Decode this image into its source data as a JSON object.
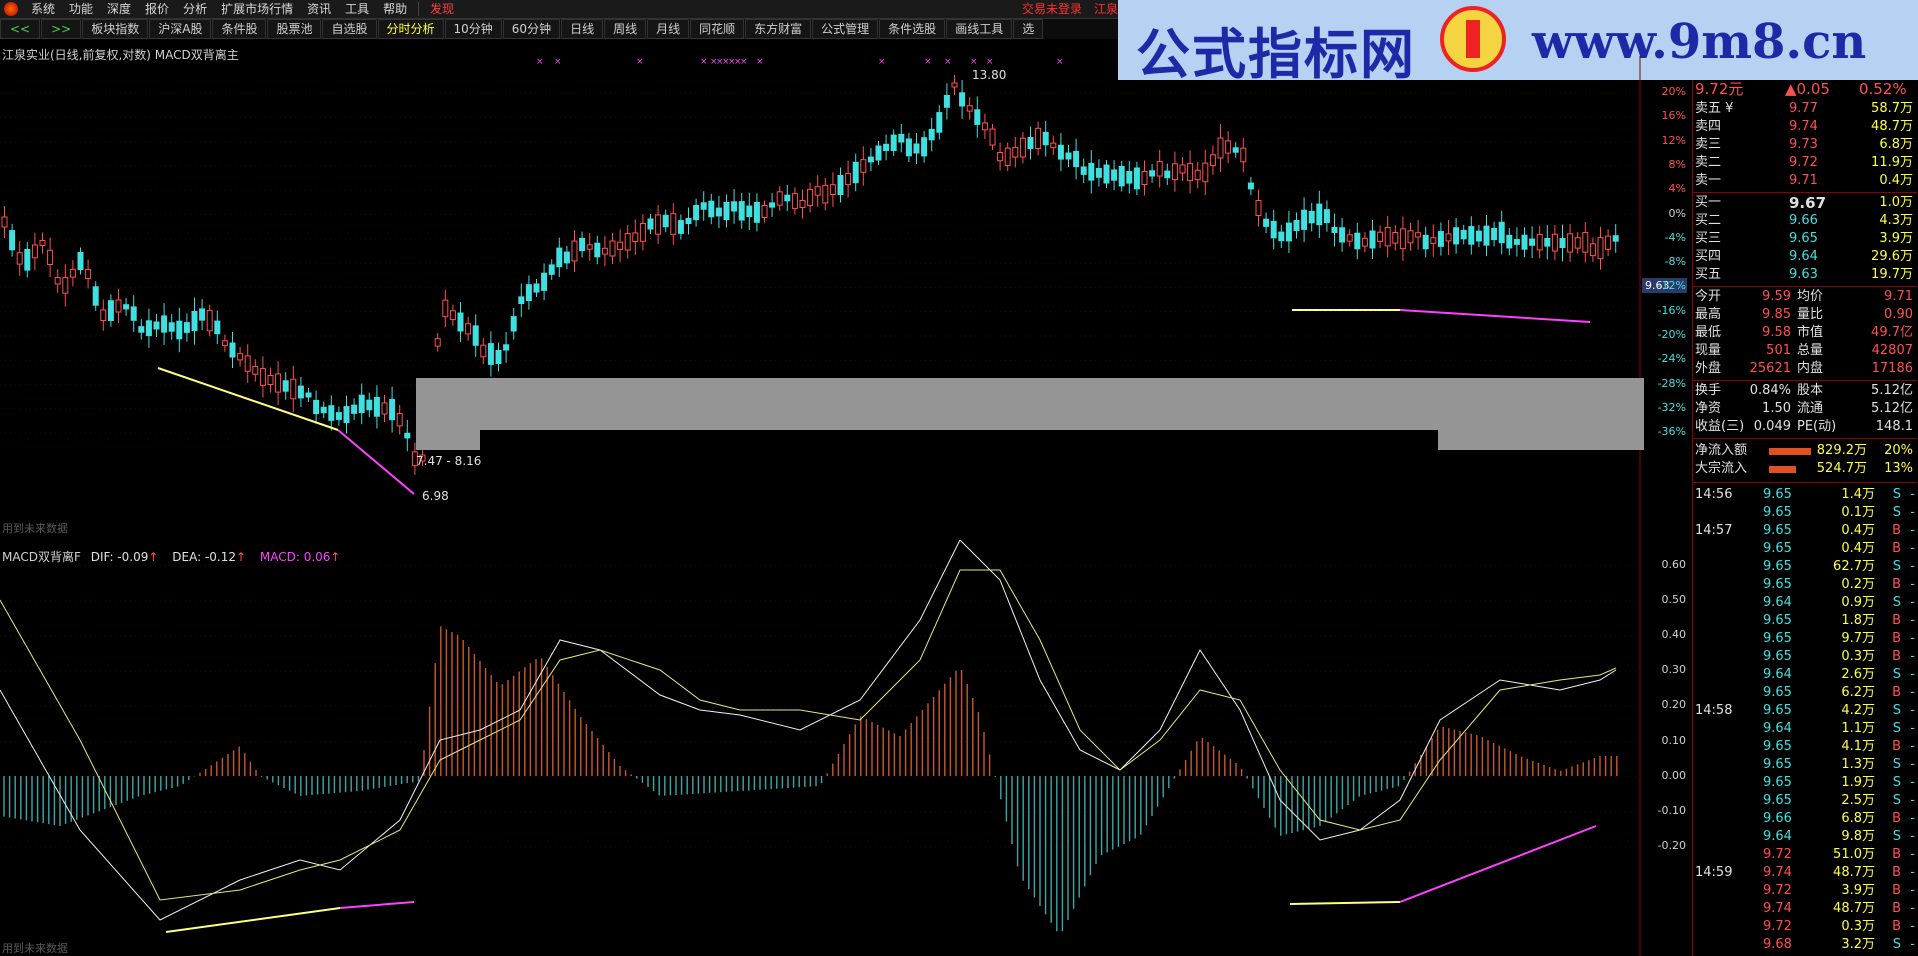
{
  "menu": {
    "items": [
      "系统",
      "功能",
      "深度",
      "报价",
      "分析",
      "扩展市场行情",
      "资讯",
      "工具",
      "帮助"
    ],
    "highlight": "发现",
    "right_links": [
      "交易未登录",
      "江泉实"
    ]
  },
  "toolbar": {
    "nav_back": "<<",
    "nav_fwd": ">>",
    "buttons": [
      "板块指数",
      "沪深A股",
      "条件股",
      "股票池",
      "自选股",
      "分时分析",
      "10分钟",
      "60分钟",
      "日线",
      "周线",
      "月线",
      "同花顺",
      "东方财富",
      "公式管理",
      "条件选股",
      "画线工具",
      "选"
    ],
    "active": "分时分析"
  },
  "banner": {
    "title": "公式指标网",
    "url": "www.9m8.cn"
  },
  "chart": {
    "title": "江泉实业(日线,前复权,对数) MACD双背离主",
    "high_label": "13.80",
    "range_label": "7.47 - 8.16",
    "low_label": "6.98",
    "future_note": "用到未来数据",
    "current_price_tag": "9.63",
    "axis_labels": [
      "20%",
      "16%",
      "12%",
      "8%",
      "4%",
      "0%",
      "-4%",
      "-8%",
      "-12%",
      "-16%",
      "-20%",
      "-24%",
      "-28%",
      "-32%",
      "-36%"
    ],
    "colors": {
      "up": "#ff5050",
      "down": "#40e0e0",
      "yellow": "#ffff80",
      "magenta": "#ff40ff"
    }
  },
  "macd": {
    "label": "MACD双背离F",
    "dif": "DIF: -0.09",
    "dea": "DEA: -0.12",
    "macd": "MACD: 0.06",
    "arrow": "↑",
    "axis_labels": [
      "0.60",
      "0.50",
      "0.40",
      "0.30",
      "0.20",
      "0.10",
      "0.00",
      "-0.10",
      "-0.20"
    ],
    "future_note": "用到未来数据"
  },
  "quote": {
    "price": "9.72元",
    "change": "▲0.05",
    "pct": "0.52%",
    "asks": [
      {
        "label": "卖五 ¥",
        "price": "9.77",
        "vol": "58.7万"
      },
      {
        "label": "卖四",
        "price": "9.74",
        "vol": "48.7万"
      },
      {
        "label": "卖三",
        "price": "9.73",
        "vol": "6.8万"
      },
      {
        "label": "卖二",
        "price": "9.72",
        "vol": "11.9万"
      },
      {
        "label": "卖一",
        "price": "9.71",
        "vol": "0.4万"
      }
    ],
    "bids": [
      {
        "label": "买一",
        "price": "9.67",
        "vol": "1.0万"
      },
      {
        "label": "买二",
        "price": "9.66",
        "vol": "4.3万"
      },
      {
        "label": "买三",
        "price": "9.65",
        "vol": "3.9万"
      },
      {
        "label": "买四",
        "price": "9.64",
        "vol": "29.6万"
      },
      {
        "label": "买五",
        "price": "9.63",
        "vol": "19.7万"
      }
    ],
    "stats": [
      {
        "l1": "今开",
        "v1": "9.59",
        "l2": "均价",
        "v2": "9.71"
      },
      {
        "l1": "最高",
        "v1": "9.85",
        "l2": "量比",
        "v2": "0.90"
      },
      {
        "l1": "最低",
        "v1": "9.58",
        "l2": "市值",
        "v2": "49.7亿"
      },
      {
        "l1": "现量",
        "v1": "501",
        "l2": "总量",
        "v2": "42807"
      },
      {
        "l1": "外盘",
        "v1": "25621",
        "l2": "内盘",
        "v2": "17186"
      }
    ],
    "stats2": [
      {
        "l1": "换手",
        "v1": "0.84%",
        "l2": "股本",
        "v2": "5.12亿"
      },
      {
        "l1": "净资",
        "v1": "1.50",
        "l2": "流通",
        "v2": "5.12亿"
      },
      {
        "l1": "收益(三)",
        "v1": "0.049",
        "l2": "PE(动)",
        "v2": "148.1"
      }
    ],
    "flows": [
      {
        "label": "净流入额",
        "value": "829.2万",
        "pct": "20%",
        "frac": 0.2
      },
      {
        "label": "大宗流入",
        "value": "524.7万",
        "pct": "13%",
        "frac": 0.13
      }
    ]
  },
  "ticks": [
    {
      "time": "14:56",
      "price": "9.65",
      "vol": "1.4万",
      "side": "S"
    },
    {
      "time": "",
      "price": "9.65",
      "vol": "0.1万",
      "side": "S"
    },
    {
      "time": "14:57",
      "price": "9.65",
      "vol": "0.4万",
      "side": "B"
    },
    {
      "time": "",
      "price": "9.65",
      "vol": "0.4万",
      "side": "B"
    },
    {
      "time": "",
      "price": "9.65",
      "vol": "62.7万",
      "side": "S"
    },
    {
      "time": "",
      "price": "9.65",
      "vol": "0.2万",
      "side": "B"
    },
    {
      "time": "",
      "price": "9.64",
      "vol": "0.9万",
      "side": "S"
    },
    {
      "time": "",
      "price": "9.65",
      "vol": "1.8万",
      "side": "B"
    },
    {
      "time": "",
      "price": "9.65",
      "vol": "9.7万",
      "side": "B"
    },
    {
      "time": "",
      "price": "9.65",
      "vol": "0.3万",
      "side": "B"
    },
    {
      "time": "",
      "price": "9.64",
      "vol": "2.6万",
      "side": "S"
    },
    {
      "time": "",
      "price": "9.65",
      "vol": "6.2万",
      "side": "B"
    },
    {
      "time": "14:58",
      "price": "9.65",
      "vol": "4.2万",
      "side": "S"
    },
    {
      "time": "",
      "price": "9.64",
      "vol": "1.1万",
      "side": "S"
    },
    {
      "time": "",
      "price": "9.65",
      "vol": "4.1万",
      "side": "B"
    },
    {
      "time": "",
      "price": "9.65",
      "vol": "1.3万",
      "side": "S"
    },
    {
      "time": "",
      "price": "9.65",
      "vol": "1.9万",
      "side": "S"
    },
    {
      "time": "",
      "price": "9.65",
      "vol": "2.5万",
      "side": "S"
    },
    {
      "time": "",
      "price": "9.66",
      "vol": "6.8万",
      "side": "B"
    },
    {
      "time": "",
      "price": "9.64",
      "vol": "9.8万",
      "side": "S"
    },
    {
      "time": "",
      "price": "9.72",
      "vol": "51.0万",
      "side": "B"
    },
    {
      "time": "14:59",
      "price": "9.74",
      "vol": "48.7万",
      "side": "B"
    },
    {
      "time": "",
      "price": "9.72",
      "vol": "3.9万",
      "side": "B"
    },
    {
      "time": "",
      "price": "9.74",
      "vol": "48.7万",
      "side": "B"
    },
    {
      "time": "",
      "price": "9.72",
      "vol": "0.3万",
      "side": "B"
    },
    {
      "time": "",
      "price": "9.68",
      "vol": "3.2万",
      "side": "S"
    }
  ]
}
